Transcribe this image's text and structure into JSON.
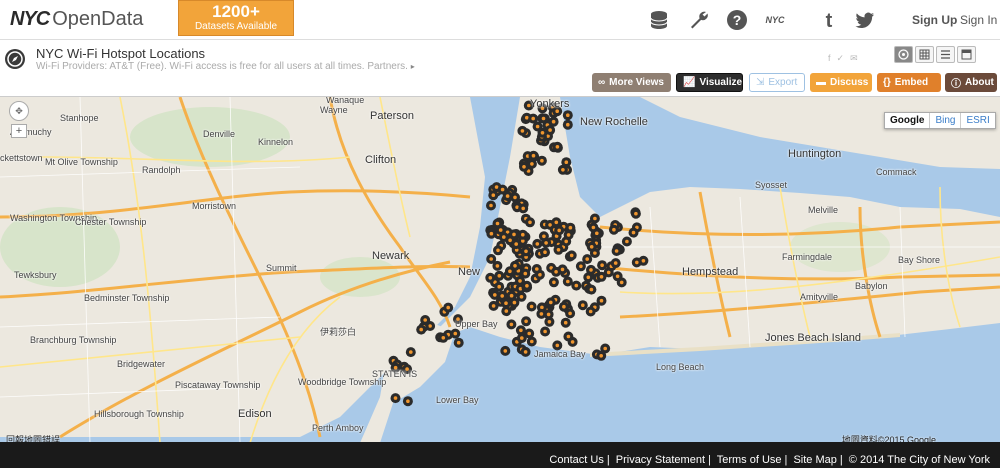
{
  "header": {
    "logo_nyc": "NYC",
    "logo_opendata": "OpenData",
    "badge_count": "1200+",
    "badge_label": "Datasets Available",
    "sign_up": "Sign Up",
    "sign_in": "Sign In",
    "nyc_icon_label": "NYC"
  },
  "dataset": {
    "title": "NYC Wi-Fi Hotspot Locations",
    "description": "Wi-Fi Providers: AT&T (Free). Wi-Fi access is free for all users at all times. Partners."
  },
  "actions": {
    "more_views": "More Views",
    "visualize": "Visualize",
    "export": "Export",
    "discuss": "Discuss",
    "embed": "Embed",
    "about": "About"
  },
  "map": {
    "map_types": [
      "Google",
      "Bing",
      "ESRI"
    ],
    "selected_map_type": "Google",
    "attribution_left": "回報地圖錯誤",
    "attribution_right": "地圖資料©2015 Google",
    "marker_color": "#2b2b2b",
    "marker_center_color": "#f0962e",
    "places": {
      "yonkers": "Yonkers",
      "new_rochelle": "New Rochelle",
      "paterson": "Paterson",
      "wayne": "Wayne",
      "clifton": "Clifton",
      "newark": "Newark",
      "new_york": "New",
      "elizabeth": "伊莉莎白",
      "staten_island": "STATEN IS",
      "perth_amboy": "Perth Amboy",
      "edison": "Edison",
      "hempstead": "Hempstead",
      "huntington": "Huntington",
      "commack": "Commack",
      "syosset": "Syosset",
      "melville": "Melville",
      "farmingdale": "Farmingdale",
      "amityville": "Amityville",
      "babylon": "Babylon",
      "bay_shore": "Bay Shore",
      "jones_beach": "Jones Beach Island",
      "long_beach": "Long Beach",
      "morristown": "Morristown",
      "randolph": "Randolph",
      "summit": "Summit",
      "bridgewater": "Bridgewater",
      "piscataway": "Piscataway Township",
      "woodbridge": "Woodbridge Township",
      "denville": "Denville",
      "wanaque": "Wanaque",
      "kinnelon": "Kinnelon",
      "jamaica_bay": "Jamaica Bay",
      "lower_bay": "Lower Bay",
      "upper_bay": "Upper Bay",
      "rockettstown": "ckettstown",
      "mt_olive": "Mt Olive Township",
      "washington": "Washington Township",
      "chester": "Chester Township",
      "tewksbury": "Tewksbury",
      "bedminster": "Bedminster Township",
      "branchburg": "Branchburg Township",
      "hillsborough": "Hillsborough Township",
      "stanhope": "Stanhope",
      "allamuchy": "Allamuchy"
    }
  },
  "footer": {
    "links": [
      "Contact Us",
      "Privacy Statement",
      "Terms of Use",
      "Site Map"
    ],
    "copyright": "© 2014 The City of New York"
  }
}
